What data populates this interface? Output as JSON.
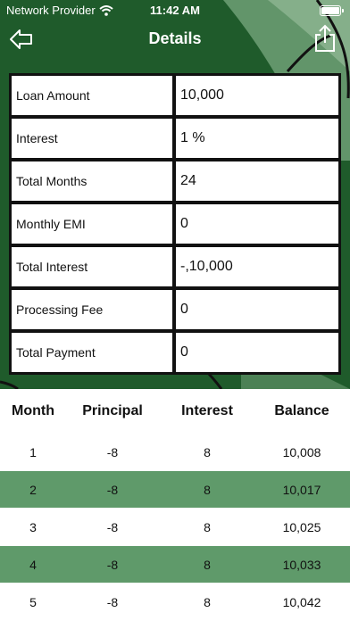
{
  "status_bar": {
    "carrier": "Network Provider",
    "time": "11:42 AM"
  },
  "nav": {
    "title": "Details",
    "back_icon": "back-arrow-icon",
    "share_icon": "share-icon"
  },
  "colors": {
    "header_green": "#1f5b2b",
    "row_highlight": "#5f9a6a"
  },
  "details": [
    {
      "label": "Loan Amount",
      "value": "10,000"
    },
    {
      "label": "Interest",
      "value": "1 %"
    },
    {
      "label": "Total Months",
      "value": "24"
    },
    {
      "label": "Monthly EMI",
      "value": "0"
    },
    {
      "label": "Total Interest",
      "value": "-,10,000"
    },
    {
      "label": "Processing Fee",
      "value": "0"
    },
    {
      "label": "Total Payment",
      "value": "0"
    }
  ],
  "schedule": {
    "columns": [
      "Month",
      "Principal",
      "Interest",
      "Balance"
    ],
    "rows": [
      [
        "1",
        "-8",
        "8",
        "10,008"
      ],
      [
        "2",
        "-8",
        "8",
        "10,017"
      ],
      [
        "3",
        "-8",
        "8",
        "10,025"
      ],
      [
        "4",
        "-8",
        "8",
        "10,033"
      ],
      [
        "5",
        "-8",
        "8",
        "10,042"
      ]
    ]
  }
}
